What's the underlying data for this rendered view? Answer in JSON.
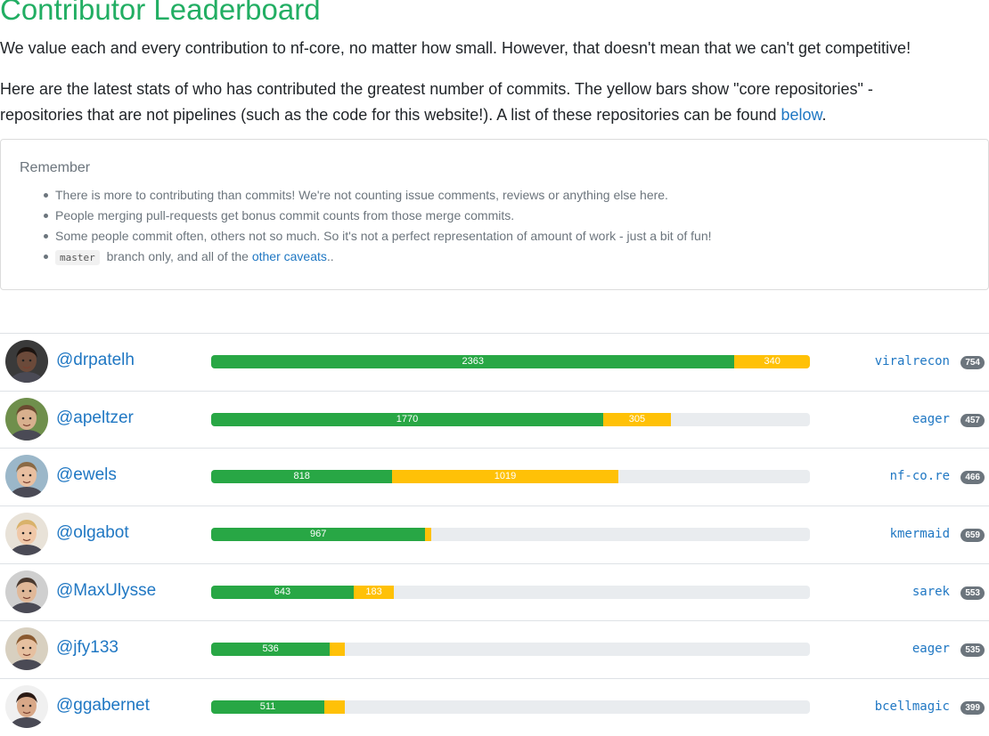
{
  "page": {
    "title": "Contributor Leaderboard",
    "intro1": "We value each and every contribution to nf-core, no matter how small. However, that doesn't mean that we can't get competitive!",
    "intro2_before": "Here are the latest stats of who has contributed the greatest number of commits. The yellow bars show \"core repositories\" - repositories that are not pipelines (such as the code for this website!). A list of these repositories can be found ",
    "intro2_link": "below",
    "intro2_after": "."
  },
  "remember": {
    "heading": "Remember",
    "items": [
      "There is more to contributing than commits! We're not counting issue comments, reviews or anything else here.",
      "People merging pull-requests get bonus commit counts from those merge commits.",
      "Some people commit often, others not so much. So it's not a perfect representation of amount of work - just a bit of fun!"
    ],
    "last_code": "master",
    "last_text": " branch only, and all of the ",
    "last_link": "other caveats",
    "last_end": ".."
  },
  "colors": {
    "pipeline": "#28a745",
    "core": "#ffc107",
    "track": "#e9ecef",
    "title": "#22ae63",
    "link": "#1f77c3"
  },
  "leaderboard": {
    "bar_max": 2703,
    "rows": [
      {
        "username": "@drpatelh",
        "pipeline": 2363,
        "pipeline_label": "2363",
        "core": 340,
        "core_label": "340",
        "top_repo": "viralrecon",
        "top_repo_count": "754",
        "avatar": {
          "skin": "#6b4a3a",
          "hair": "#1c1410",
          "bg": "#3a3a3a"
        }
      },
      {
        "username": "@apeltzer",
        "pipeline": 1770,
        "pipeline_label": "1770",
        "core": 305,
        "core_label": "305",
        "top_repo": "eager",
        "top_repo_count": "457",
        "avatar": {
          "skin": "#d8b08e",
          "hair": "#6a4a30",
          "bg": "#6f8f4c"
        }
      },
      {
        "username": "@ewels",
        "pipeline": 818,
        "pipeline_label": "818",
        "core": 1019,
        "core_label": "1019",
        "top_repo": "nf-co.re",
        "top_repo_count": "466",
        "avatar": {
          "skin": "#e8bfa0",
          "hair": "#8a6a45",
          "bg": "#9bb7c9"
        }
      },
      {
        "username": "@olgabot",
        "pipeline": 967,
        "pipeline_label": "967",
        "core": 28,
        "core_label": "",
        "top_repo": "kmermaid",
        "top_repo_count": "659",
        "avatar": {
          "skin": "#f0c8a8",
          "hair": "#d9b26a",
          "bg": "#e8e2d8"
        }
      },
      {
        "username": "@MaxUlysse",
        "pipeline": 643,
        "pipeline_label": "643",
        "core": 183,
        "core_label": "183",
        "top_repo": "sarek",
        "top_repo_count": "553",
        "avatar": {
          "skin": "#e0b898",
          "hair": "#4a3a30",
          "bg": "#cfcfcf"
        }
      },
      {
        "username": "@jfy133",
        "pipeline": 536,
        "pipeline_label": "536",
        "core": 68,
        "core_label": "",
        "top_repo": "eager",
        "top_repo_count": "535",
        "avatar": {
          "skin": "#e6c0a0",
          "hair": "#8a5a30",
          "bg": "#d8d0c0"
        }
      },
      {
        "username": "@ggabernet",
        "pipeline": 511,
        "pipeline_label": "511",
        "core": 92,
        "core_label": "",
        "top_repo": "bcellmagic",
        "top_repo_count": "399",
        "avatar": {
          "skin": "#d8a888",
          "hair": "#2a1a14",
          "bg": "#f0f0f0"
        }
      }
    ]
  }
}
